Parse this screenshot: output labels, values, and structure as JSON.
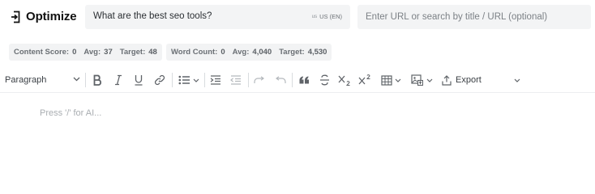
{
  "header": {
    "title": "Optimize",
    "keyword": "What are the best seo tools?",
    "region": {
      "flag": "us",
      "label": "US (EN)"
    },
    "url_input": {
      "value": "",
      "placeholder": "Enter URL or search by title / URL (optional)"
    }
  },
  "metrics": {
    "content": {
      "label_score": "Content Score:",
      "score": "0",
      "label_avg": "Avg:",
      "avg": "37",
      "label_target": "Target:",
      "target": "48"
    },
    "words": {
      "label_count": "Word Count:",
      "count": "0",
      "label_avg": "Avg:",
      "avg": "4,040",
      "label_target": "Target:",
      "target": "4,530"
    }
  },
  "toolbar": {
    "block_type": "Paragraph",
    "export_label": "Export",
    "icons": [
      "bold-icon",
      "italic-icon",
      "underline-icon",
      "link-icon",
      "bullet-list-icon",
      "indent-icon",
      "outdent-icon",
      "redo-icon",
      "undo-icon",
      "quote-icon",
      "strikethrough-icon",
      "subscript-icon",
      "superscript-icon",
      "table-icon",
      "image-icon",
      "export-icon"
    ]
  },
  "editor": {
    "placeholder": "Press '/' for AI..."
  },
  "colors": {
    "icon": "#5f6368",
    "disabled_icon": "#b5b9bd",
    "field_bg": "#f3f4f5",
    "pill_bg": "#f2f3f4"
  }
}
